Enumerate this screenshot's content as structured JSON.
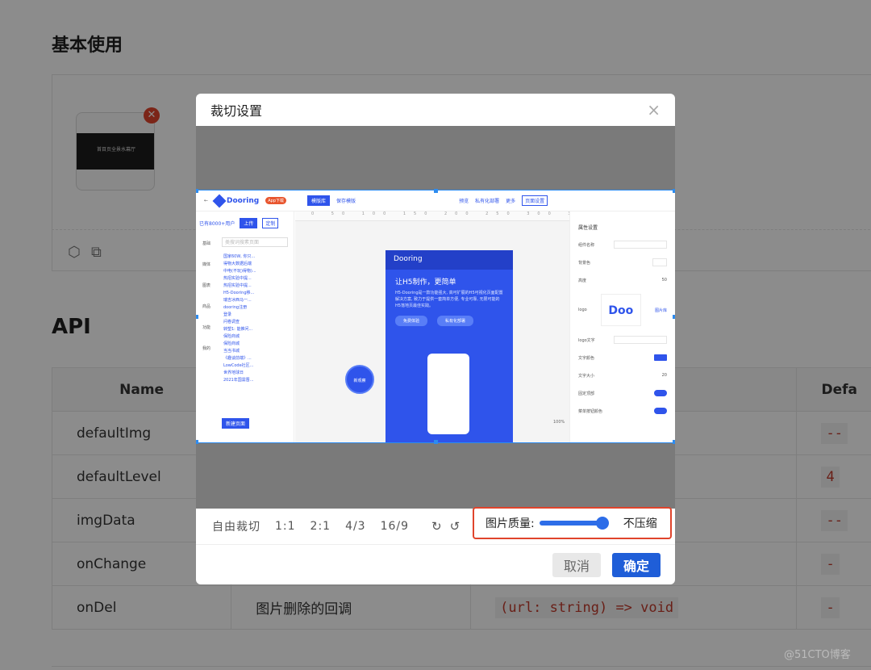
{
  "page": {
    "basic_title": "基本使用",
    "api_title": "API",
    "watermark": "@51CTO博客"
  },
  "demo": {
    "thumb_text": "首目页全景水幕厅",
    "delete_icon": "close-icon",
    "icons": [
      "cube-icon",
      "external-link-icon"
    ]
  },
  "table": {
    "headers": [
      "Name",
      "",
      "",
      "Defa"
    ],
    "rows": [
      {
        "name": "defaultImg",
        "desc": "",
        "type": "",
        "default": "--"
      },
      {
        "name": "defaultLevel",
        "desc": "",
        "type": "",
        "default": "4"
      },
      {
        "name": "imgData",
        "desc": "",
        "type": "",
        "default": "--"
      },
      {
        "name": "onChange",
        "desc": "",
        "type": "",
        "default": "-"
      },
      {
        "name": "onDel",
        "desc": "图片删除的回调",
        "type": "(url: string) => void",
        "default": "-"
      }
    ]
  },
  "modal": {
    "title": "裁切设置",
    "close": "×",
    "toolbar": {
      "free": "自由裁切",
      "ratios": [
        "1:1",
        "2:1",
        "4/3",
        "16/9"
      ],
      "rotate_right": "↻",
      "rotate_left": "↺"
    },
    "quality": {
      "label": "图片质量:",
      "value_label": "不压缩",
      "level": 1.0
    },
    "cancel": "取消",
    "ok": "确定"
  },
  "editor": {
    "logo": "Dooring",
    "badge": "App下载",
    "top_buttons": [
      "模版库",
      "保存模版"
    ],
    "top_tools": [
      "预览",
      "私有化部署",
      "更多",
      "页面设置"
    ],
    "left_actions": [
      "上传",
      "定制"
    ],
    "left_count": "已有8000+用户",
    "search_placeholder": "类搜词搜素页面",
    "search_button": "查",
    "left_nav": [
      "基础",
      "媒体",
      "图表",
      "商品",
      "功能",
      "我的"
    ],
    "pages": [
      "国家60W, 你只...",
      "得物大数据后端",
      "中电(不玩)得物)...",
      "热招实验中提...",
      "热招实验中提...",
      "H5-Dooring移...",
      "瑞吉冰西马一...",
      "dooring注册",
      "登录",
      "问卷调查",
      "转塑1: 能推问...",
      "保险商城",
      "保险商城",
      "当当书城",
      "《趣谈前端》...",
      "LowCode社区...",
      "世界地球日",
      "2021年国需晋..."
    ],
    "new_page": "新建页面",
    "ruler": "0 50 100 150 200 250 300 350 400 450 500 550 600 650 700 750",
    "phone_logo": "Dooring",
    "phone_title": "让H5制作，更简单",
    "phone_text": "H5-Dooring是一款功能强大, 高可扩展的H5可视化页面配置解决方案, 致力于提供一套简单方便, 专业可靠, 无限可能的H5落地页最佳实践。",
    "phone_buttons": [
      "免费体验",
      "私有化部署"
    ],
    "circle": "新观察",
    "zoom": "100%",
    "right_title": "属性设置",
    "right_rows": [
      "组件名称",
      "背景色",
      "高度",
      "logo",
      "logo文字",
      "文字颜色",
      "文字大小",
      "固定顶部",
      "菜单按钮颜色"
    ],
    "height_value": "50",
    "font_value": "20",
    "logo_preview": "Doo",
    "logo_lib": "图片库"
  }
}
